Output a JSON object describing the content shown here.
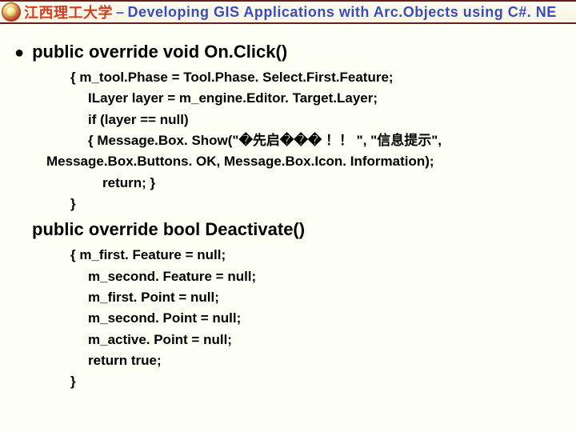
{
  "header": {
    "uni": "江西理工大学",
    "dash": "–",
    "title": "Developing GIS Applications with Arc.Objects using C#. NE"
  },
  "bullet": "●",
  "sig1": "public override void On.Click()",
  "c1": {
    "o": "{   m_tool.Phase = Tool.Phase. Select.First.Feature;",
    "l1": "ILayer layer = m_engine.Editor. Target.Layer;",
    "l2": "if (layer == null)",
    "l3": "{   Message.Box. Show(\"�先启��� ！！ \", \"信息提示\",",
    "l4": "Message.Box.Buttons. OK, Message.Box.Icon. Information);",
    "l5": "return;    }",
    "c": "}"
  },
  "sig2": "public override bool Deactivate()",
  "c2": {
    "o": "{   m_first. Feature = null;",
    "l1": "m_second. Feature = null;",
    "l2": "m_first. Point = null;",
    "l3": "m_second. Point = null;",
    "l4": "m_active. Point = null;",
    "l5": "return true;",
    "c": "}"
  }
}
